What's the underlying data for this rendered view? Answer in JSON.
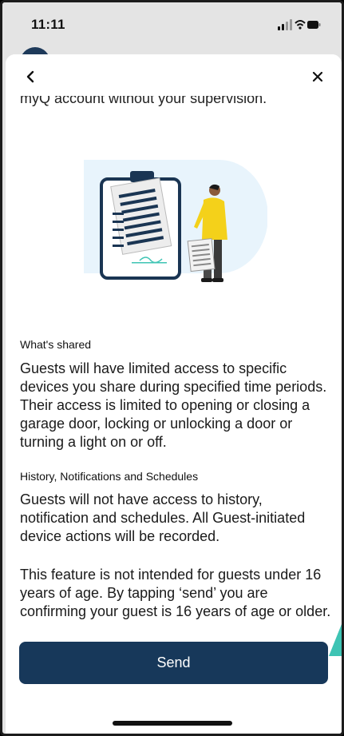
{
  "status_bar": {
    "time": "11:11",
    "icons": [
      "cellular-signal-icon",
      "wifi-icon",
      "battery-icon"
    ]
  },
  "nav": {
    "back_icon": "chevron-left-icon",
    "close_icon": "close-icon"
  },
  "content": {
    "cut_off_text": "myQ account without your supervision.",
    "illustration": "clipboard-and-person-illustration",
    "sections": [
      {
        "title": "What's shared",
        "body": "Guests will have limited access to specific devices you share during specified time periods. Their access is limited to opening or closing a garage door, locking or unlocking a door or turning a light on or off."
      },
      {
        "title": "History, Notifications and Schedules",
        "body": "Guests will not have access to history, notification and schedules. All Guest-initiated device actions will be recorded."
      }
    ],
    "disclaimer": "This feature is not intended for guests under 16 years of age. By tapping ‘send’ you are confirming your guest is 16 years of age or older."
  },
  "actions": {
    "send_label": "Send"
  },
  "colors": {
    "primary": "#17385a",
    "illustration_bg": "#e8f4fc",
    "accent_yellow": "#f4d11a",
    "accent_teal": "#3ec4b4"
  }
}
